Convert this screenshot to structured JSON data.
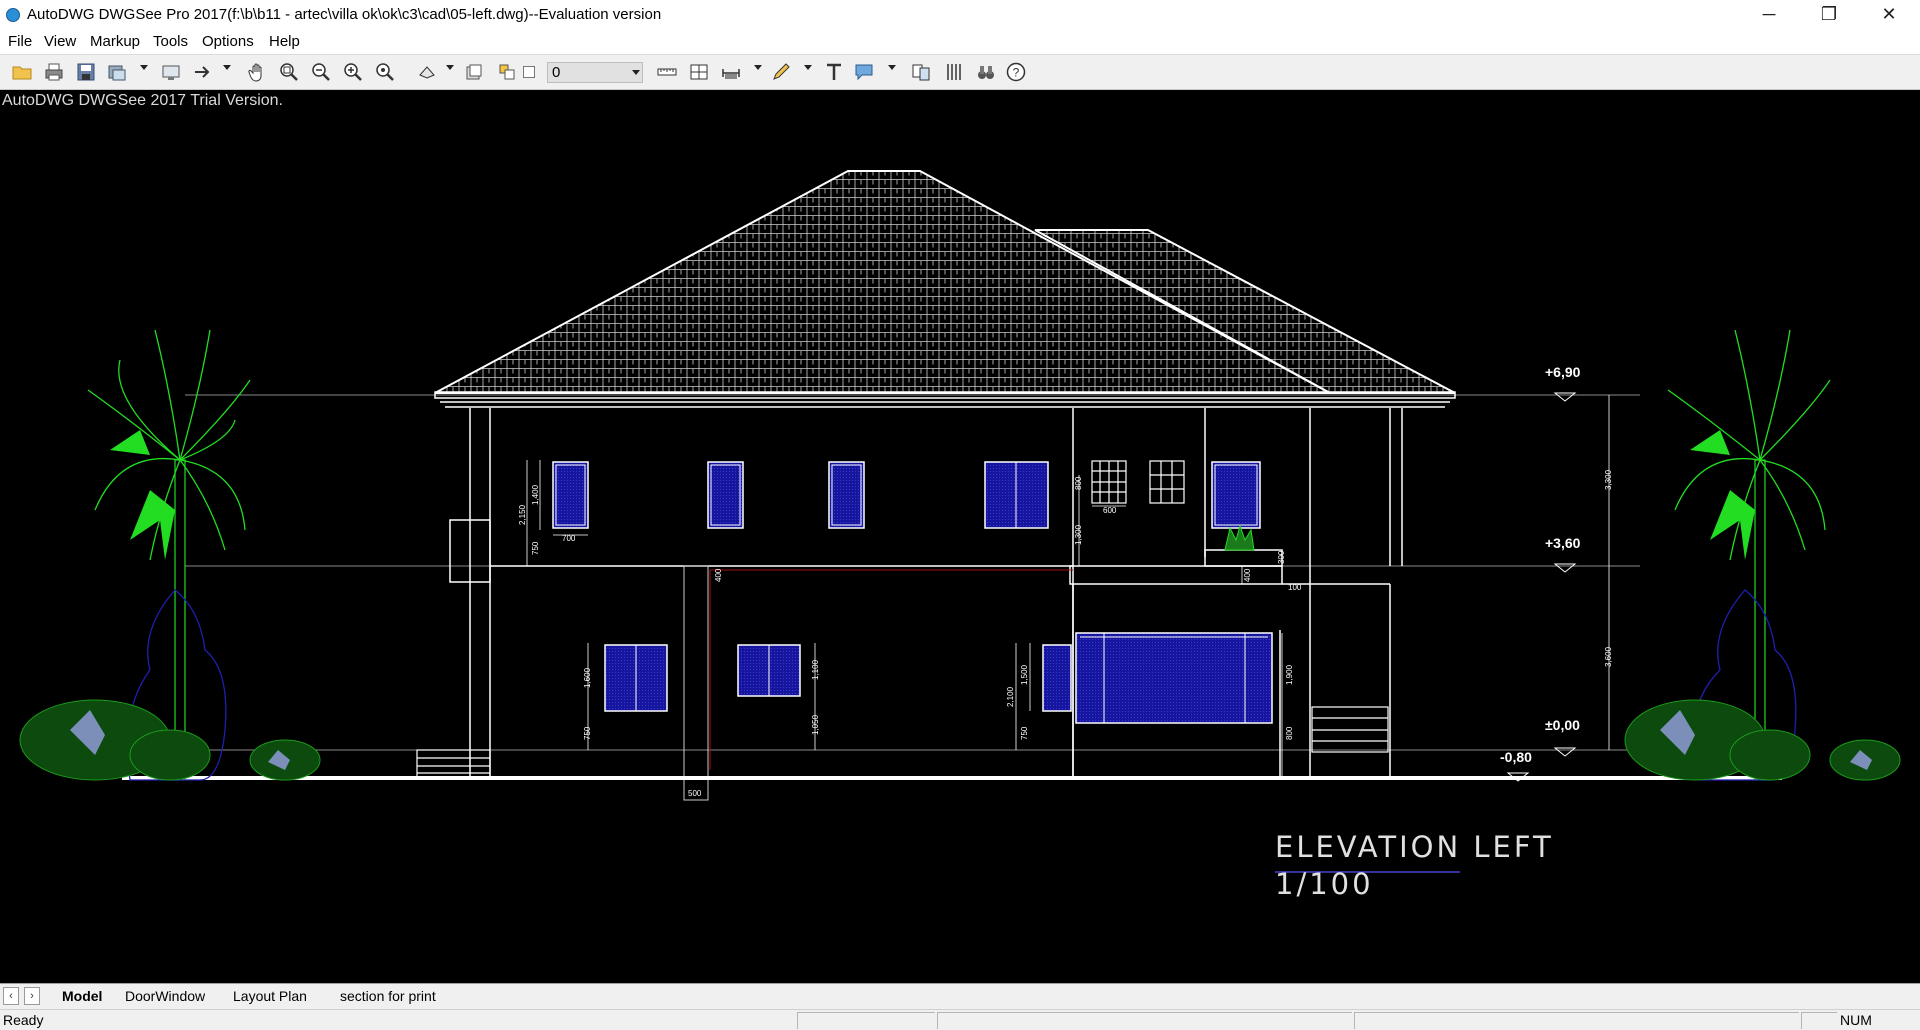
{
  "window": {
    "title": "AutoDWG DWGSee Pro 2017(f:\\b\\b11 - artec\\villa ok\\ok\\c3\\cad\\05-left.dwg)--Evaluation version",
    "minimize_glyph": "─",
    "maximize_glyph": "❐",
    "close_glyph": "✕"
  },
  "menu": [
    "File",
    "View",
    "Markup",
    "Tools",
    "Options",
    "Help"
  ],
  "toolbar": {
    "layer_value": "0",
    "icons": [
      "open-folder-icon",
      "print-icon",
      "save-icon",
      "export-icon",
      "monitor-icon",
      "arrow-right-icon",
      "pan-hand-icon",
      "zoom-window-icon",
      "zoom-out-icon",
      "zoom-in-icon",
      "zoom-extents-icon",
      "layer-icon",
      "layer-states-icon",
      "measure-distance-icon",
      "measure-area-icon",
      "dimension-icon",
      "pencil-markup-icon",
      "text-icon",
      "comment-icon",
      "compare-icon",
      "block-icon",
      "binoculars-icon",
      "help-icon"
    ]
  },
  "drawing": {
    "trial_text": "AutoDWG DWGSee 2017 Trial Version.",
    "title": "ELEVATION LEFT",
    "scale": "1/100",
    "levels": [
      "+6,90",
      "+3,60",
      "±0,00",
      "-0,80"
    ],
    "dims": {
      "d2150": "2,150",
      "d1400": "1,400",
      "d700": "700",
      "d750": "750",
      "d600": "600",
      "d1300": "1,300",
      "d400": "400",
      "d100": "100",
      "d3300": "3,300",
      "d3600": "3,600",
      "d1600": "1,600",
      "d1100": "1,100",
      "d1050": "1,050",
      "d2100": "2,100",
      "d1500": "1,500",
      "d1900": "1,900",
      "d500": "500",
      "d800": "800",
      "d300": "300"
    },
    "colors": {
      "background": "#000000",
      "lines": "#ffffff",
      "glass": "#1a1aa6",
      "palm": "#22dd22",
      "shrub": "#1b7a1b",
      "bush_outline": "#1f1fb0"
    }
  },
  "tabs": [
    "Model",
    "DoorWindow",
    "Layout Plan",
    "section for print"
  ],
  "status": {
    "ready": "Ready",
    "num": "NUM"
  }
}
